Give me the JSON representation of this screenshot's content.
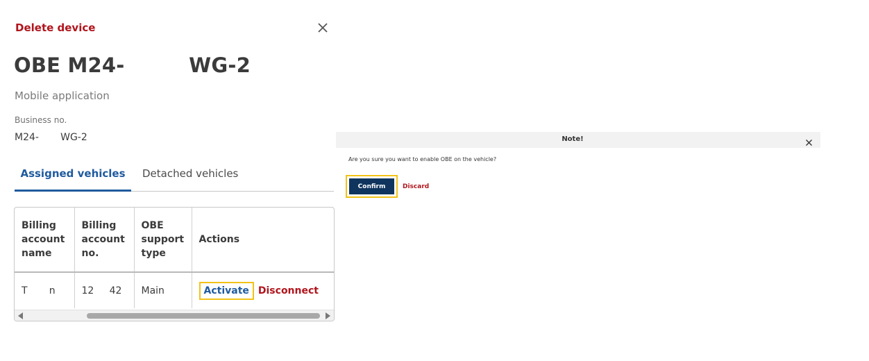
{
  "panel": {
    "delete_label": "Delete device",
    "title": "OBE M24-         WG-2",
    "subtitle": "Mobile application",
    "business_no_label": "Business no.",
    "business_no_value": "M24-       WG-2",
    "tabs": [
      {
        "label": "Assigned vehicles",
        "active": true
      },
      {
        "label": "Detached vehicles",
        "active": false
      }
    ],
    "table": {
      "headers": [
        "Billing account name",
        "Billing account no.",
        "OBE support type",
        "Actions"
      ],
      "rows": [
        {
          "name": "T       n",
          "number": "12     42",
          "type": "Main",
          "activate": "Activate",
          "disconnect": "Disconnect"
        }
      ]
    }
  },
  "note": {
    "title": "Note!",
    "message": "Are you sure you want to enable OBE on the vehicle?",
    "confirm_label": "Confirm",
    "discard_label": "Discard"
  },
  "colors": {
    "danger": "#b0151d",
    "primary": "#1f5a9e",
    "confirm_bg": "#0f355e",
    "highlight": "#f2c217"
  }
}
